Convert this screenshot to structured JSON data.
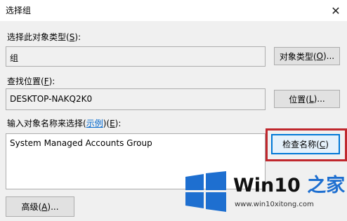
{
  "window": {
    "title": "选择组",
    "close_glyph": "✕"
  },
  "object_type": {
    "label": "选择此对象类型(",
    "label_key": "S",
    "label_tail": "):",
    "value": "组",
    "button_label": "对象类型(",
    "button_key": "O",
    "button_tail": ")..."
  },
  "location": {
    "label": "查找位置(",
    "label_key": "F",
    "label_tail": "):",
    "value": "DESKTOP-NAKQ2K0",
    "button_label": "位置(",
    "button_key": "L",
    "button_tail": ")..."
  },
  "names": {
    "label": "输入对象名称来选择(",
    "example_link": "示例",
    "label_mid": ")(",
    "label_key": "E",
    "label_tail": "):",
    "value": "System Managed Accounts Group",
    "check_button_label": "检查名称(",
    "check_button_key": "C",
    "check_button_tail": ")"
  },
  "advanced": {
    "button_label": "高级(",
    "button_key": "A",
    "button_tail": ")..."
  },
  "watermark": {
    "brand_main": "Win10",
    "brand_accent": " 之家",
    "url": "www.win10xitong.com"
  },
  "colors": {
    "highlight_box": "#c0272d",
    "logo_blue": "#1e6fd0"
  }
}
